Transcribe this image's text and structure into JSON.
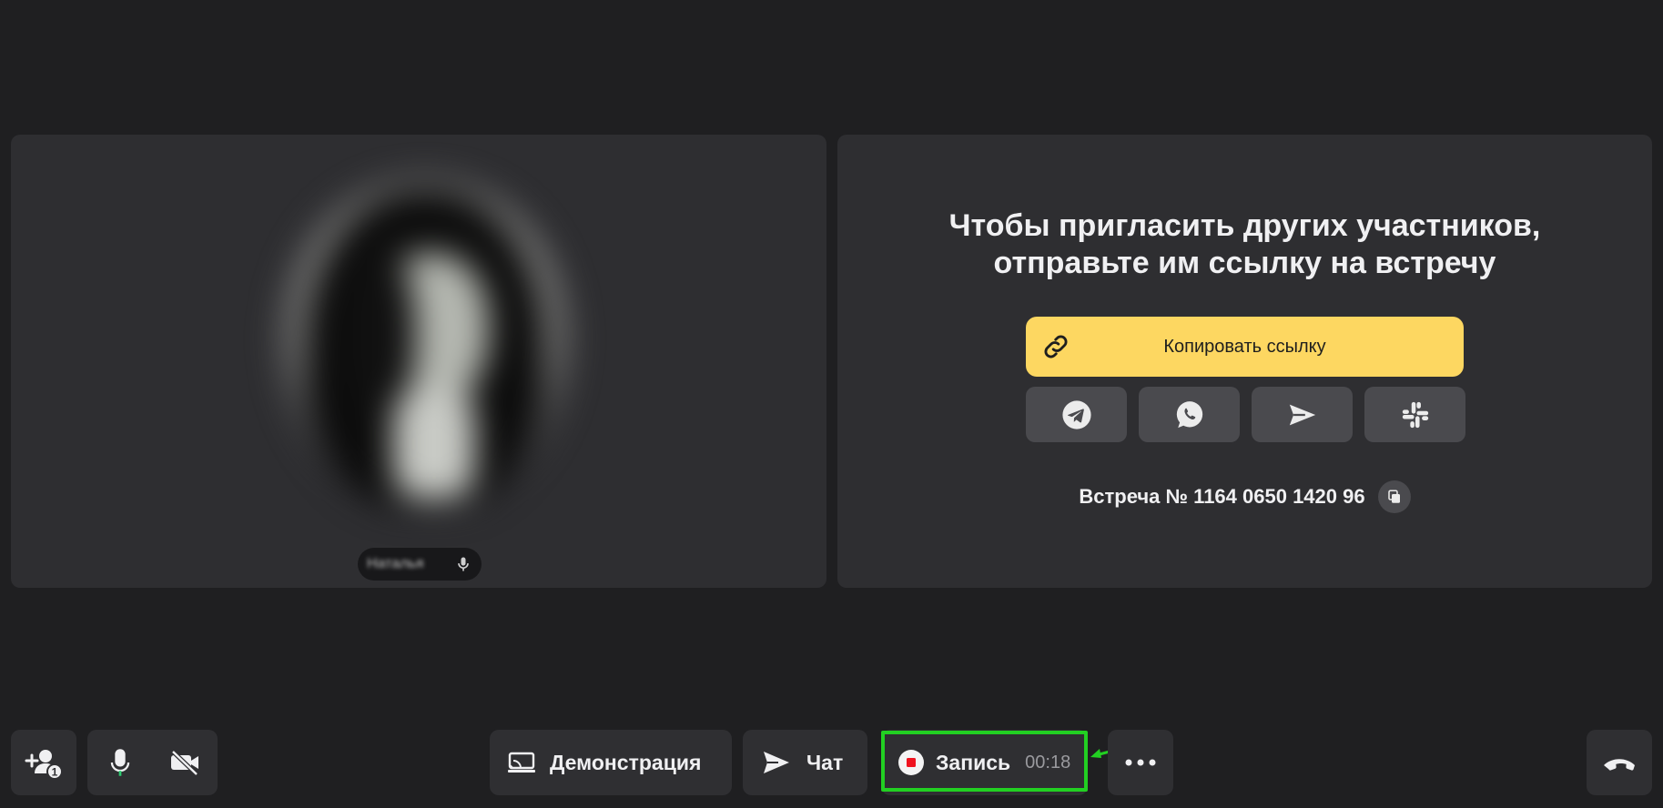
{
  "participant": {
    "name": "Наталья"
  },
  "invite": {
    "title_line1": "Чтобы пригласить других участников,",
    "title_line2": "отправьте им ссылку на встречу",
    "copy_link_label": "Копировать ссылку",
    "share_icons": [
      "telegram-icon",
      "whatsapp-icon",
      "send-icon",
      "slack-icon"
    ],
    "meeting_label": "Встреча № 1164 0650 1420 96"
  },
  "toolbar": {
    "invite_badge": "1",
    "demo_label": "Демонстрация",
    "chat_label": "Чат",
    "record_label": "Запись",
    "record_timer": "00:18"
  },
  "colors": {
    "background": "#1f1f21",
    "tile": "#2e2e31",
    "accent_yellow": "#fdd761",
    "record_red": "#f0131f",
    "highlight_green": "#22d022"
  }
}
